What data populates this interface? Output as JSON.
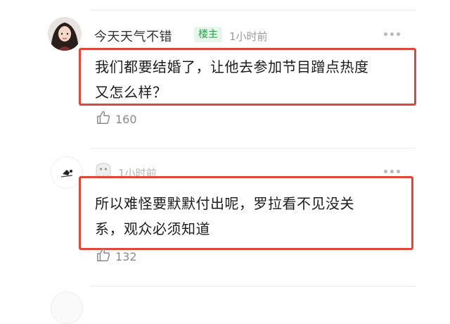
{
  "comments": [
    {
      "username": "今天天气不错",
      "badge": "楼主",
      "time": "1小时前",
      "text_lines": [
        "我们都要结婚了，让他去参加节目蹭点热度",
        "又怎么样？"
      ],
      "likes": "160"
    },
    {
      "username": "",
      "time": "1小时前",
      "text_lines": [
        "所以难怪要默默付出呢，罗拉看不见没关",
        "系，观众必须知道"
      ],
      "likes": "132"
    }
  ],
  "colors": {
    "highlight_border": "#e0473b",
    "badge_text": "#2aa14a",
    "badge_bg": "#e6f6ea",
    "muted": "#9a9a9a"
  },
  "icons": {
    "like": "thumbs-up-icon",
    "more": "more-dots-icon",
    "ghost": "ghost-icon"
  }
}
